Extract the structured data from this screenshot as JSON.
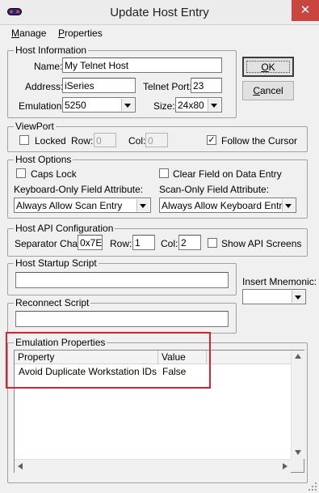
{
  "window": {
    "title": "Update Host Entry",
    "close_glyph": "✕",
    "icon": "app-icon"
  },
  "menu": {
    "items": [
      {
        "label": "Manage",
        "accel": "M",
        "rest": "anage"
      },
      {
        "label": "Properties",
        "accel": "P",
        "rest": "roperties"
      }
    ]
  },
  "host_information": {
    "legend": "Host Information",
    "name_label": "Name:",
    "name_value": "My Telnet Host",
    "address_label": "Address:",
    "address_value": "iSeries",
    "telnet_port_label": "Telnet Port:",
    "telnet_port_value": "23",
    "emulation_label": "Emulation:",
    "emulation_value": "5250",
    "size_label": "Size:",
    "size_value": "24x80"
  },
  "buttons": {
    "ok_label": "OK",
    "ok_accel": "O",
    "ok_rest": "K",
    "cancel_label": "Cancel",
    "cancel_accel": "C",
    "cancel_rest": "ancel"
  },
  "viewport": {
    "legend": "ViewPort",
    "locked_label": "Locked",
    "locked_checked": false,
    "row_label": "Row:",
    "row_value": "0",
    "col_label": "Col:",
    "col_value": "0",
    "follow_label": "Follow the Cursor",
    "follow_checked": true,
    "check_glyph": "✓"
  },
  "host_options": {
    "legend": "Host Options",
    "caps_lock_label": "Caps Lock",
    "caps_lock_checked": false,
    "clear_field_label": "Clear Field on Data Entry",
    "clear_field_checked": false,
    "kb_only_label": "Keyboard-Only Field Attribute:",
    "kb_only_value": "Always Allow Scan Entry",
    "scan_only_label": "Scan-Only Field Attribute:",
    "scan_only_value": "Always Allow Keyboard Entry"
  },
  "host_api": {
    "legend": "Host API Configuration",
    "separator_label": "Separator Char:",
    "separator_value": "0x7E",
    "row_label": "Row:",
    "row_value": "1",
    "col_label": "Col:",
    "col_value": "2",
    "show_api_label": "Show API Screens",
    "show_api_checked": false
  },
  "host_startup": {
    "legend": "Host Startup Script",
    "value": ""
  },
  "insert_mnemonic": {
    "label": "Insert Mnemonic:",
    "value": ""
  },
  "reconnect": {
    "legend": "Reconnect Script",
    "value": ""
  },
  "emulation_properties": {
    "legend": "Emulation Properties",
    "columns": [
      "Property",
      "Value"
    ],
    "rows": [
      {
        "property": "Avoid Duplicate Workstation IDs",
        "value": "False"
      }
    ]
  },
  "colors": {
    "highlight": "#d8242f",
    "close_button": "#c9453f"
  }
}
